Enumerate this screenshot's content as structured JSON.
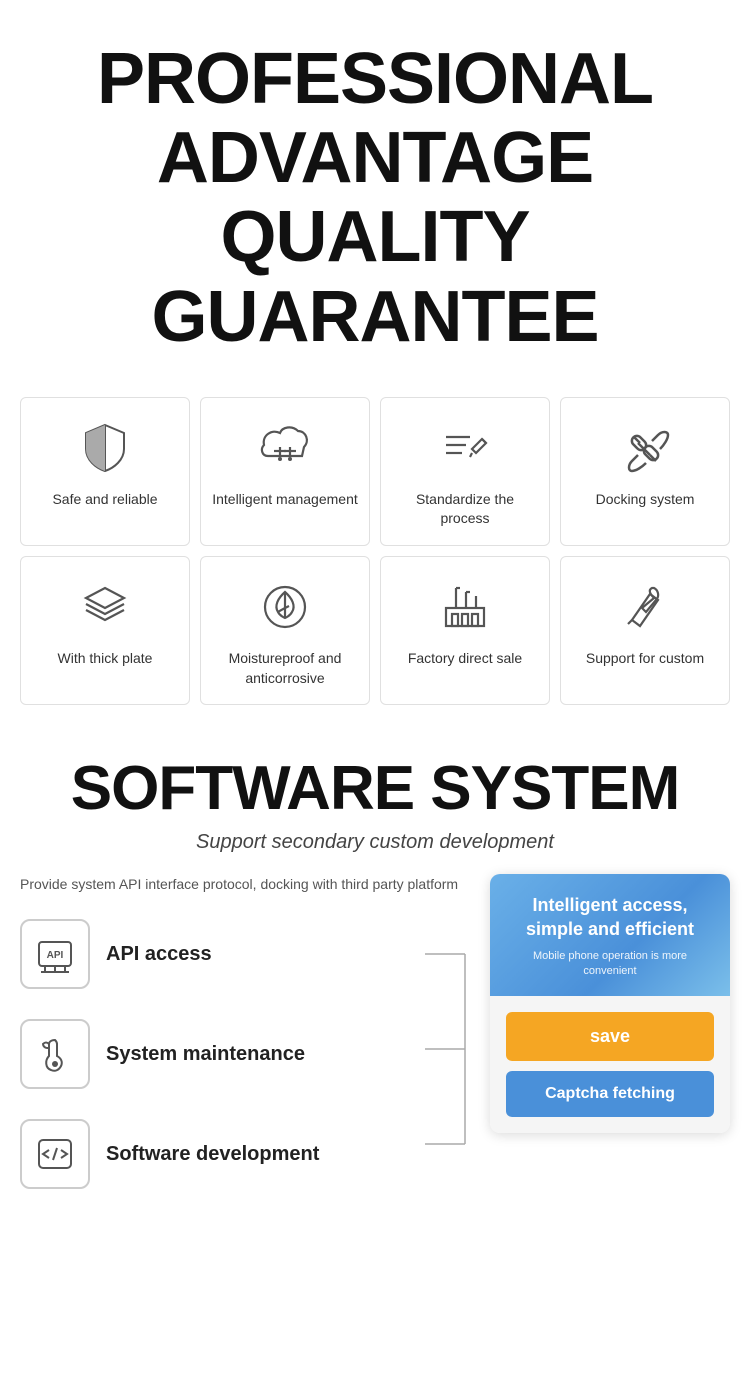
{
  "header": {
    "line1": "PROFESSIONAL",
    "line2": "ADVANTAGE",
    "line3": "QUALITY GUARANTEE"
  },
  "features_row1": [
    {
      "id": "safe-reliable",
      "label": "Safe and reliable",
      "icon": "shield"
    },
    {
      "id": "intelligent-management",
      "label": "Intelligent management",
      "icon": "cloud-settings"
    },
    {
      "id": "standardize-process",
      "label": "Standardize the process",
      "icon": "pencil-lines"
    },
    {
      "id": "docking-system",
      "label": "Docking system",
      "icon": "link"
    }
  ],
  "features_row2": [
    {
      "id": "thick-plate",
      "label": "With thick plate",
      "icon": "layers"
    },
    {
      "id": "moistureproof",
      "label": "Moistureproof and anticorrosive",
      "icon": "leaf-shield"
    },
    {
      "id": "factory-direct",
      "label": "Factory direct sale",
      "icon": "factory"
    },
    {
      "id": "support-custom",
      "label": "Support for custom",
      "icon": "tools"
    }
  ],
  "software": {
    "title": "SOFTWARE SYSTEM",
    "subtitle": "Support secondary custom development",
    "description": "Provide system API interface protocol, docking with third party platform",
    "items": [
      {
        "id": "api-access",
        "label": "API access",
        "icon": "api"
      },
      {
        "id": "system-maintenance",
        "label": "System maintenance",
        "icon": "wrench-drop"
      },
      {
        "id": "software-development",
        "label": "Software development",
        "icon": "code"
      }
    ],
    "panel": {
      "main_text": "Intelligent access, simple and efficient",
      "sub_text": "Mobile phone operation is more convenient",
      "btn_save": "save",
      "btn_captcha": "Captcha fetching"
    }
  }
}
